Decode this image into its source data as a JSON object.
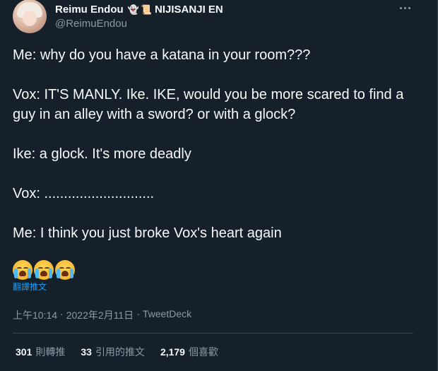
{
  "author": {
    "display_name": "Reimu Endou",
    "name_suffix": "NIJISANJI EN",
    "handle": "@ReimuEndou"
  },
  "tweet": {
    "paragraphs": [
      "Me: why do you have a katana in your room???",
      "Vox: IT'S MANLY. Ike. IKE, would you be more scared to find a guy in an alley with a sword? or with a glock?",
      "Ike: a glock. It's more deadly",
      "Vox: ............................",
      "Me: I think you just broke Vox's heart again"
    ],
    "emoji_names": [
      "loudly-crying-face",
      "loudly-crying-face",
      "loudly-crying-face"
    ],
    "translate_label": "翻譯推文"
  },
  "meta": {
    "time": "上午10:14",
    "date": "2022年2月11日",
    "source": "TweetDeck"
  },
  "stats": {
    "retweets": "301",
    "retweets_label": "則轉推",
    "quotes": "33",
    "quotes_label": "引用的推文",
    "likes": "2,179",
    "likes_label": "個喜歡"
  },
  "colors": {
    "background": "#15202b",
    "text": "#f7f9f9",
    "muted": "#8b98a5",
    "link": "#1d9bf0",
    "border": "#38444d"
  }
}
